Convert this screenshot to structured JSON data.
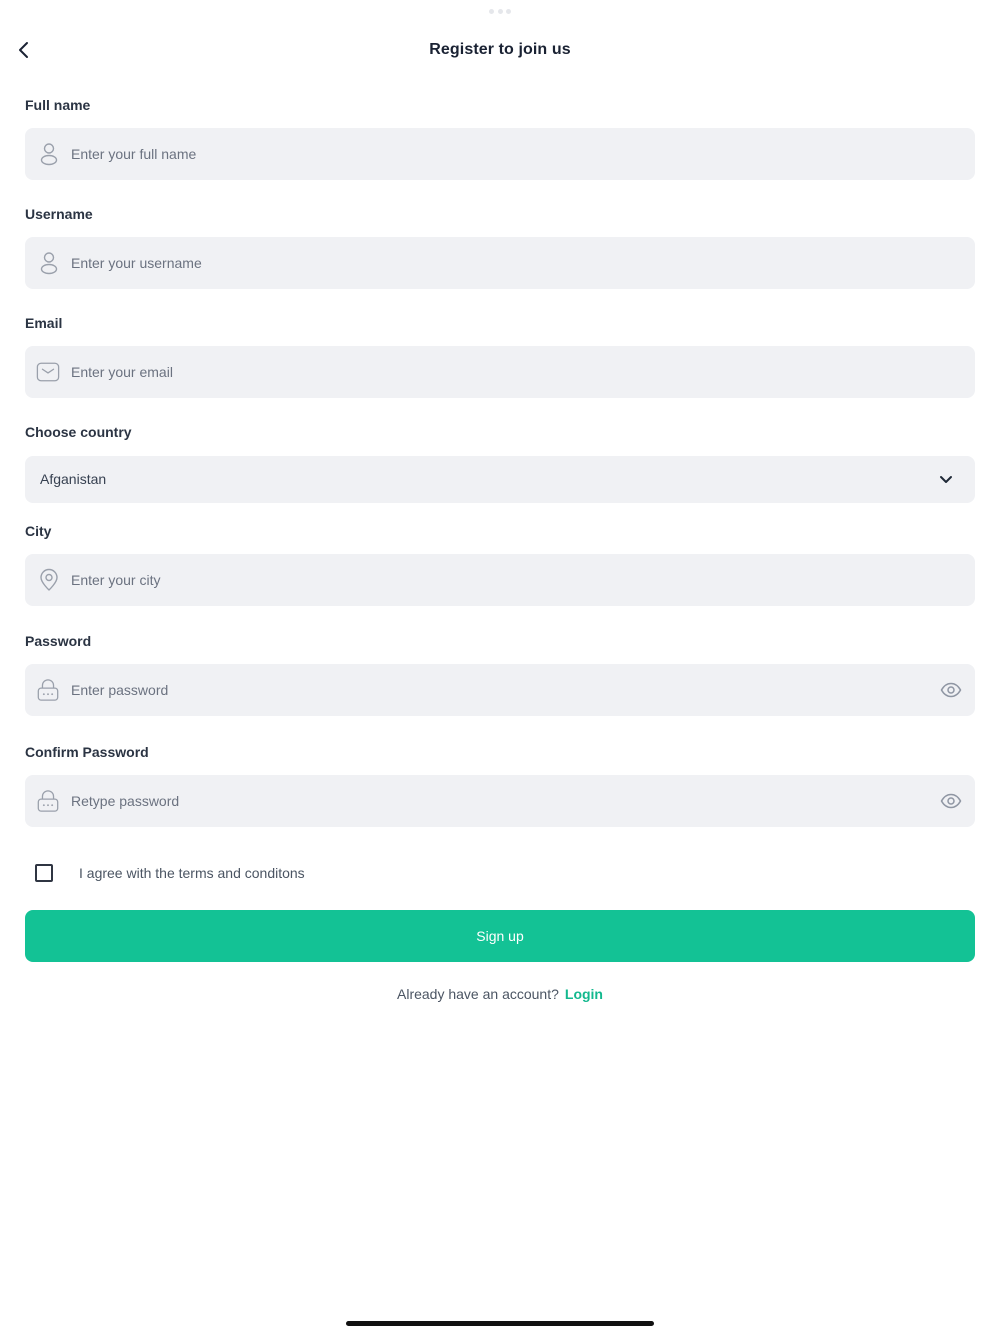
{
  "header": {
    "title": "Register to join us",
    "back_icon": "chevron-left-icon"
  },
  "form": {
    "full_name": {
      "label": "Full name",
      "placeholder": "Enter your full name",
      "value": "",
      "icon": "user-icon"
    },
    "username": {
      "label": "Username",
      "placeholder": "Enter your username",
      "value": "",
      "icon": "user-icon"
    },
    "email": {
      "label": "Email",
      "placeholder": "Enter your email",
      "value": "",
      "icon": "mail-icon"
    },
    "country": {
      "label": "Choose country",
      "selected": "Afganistan",
      "icon": "chevron-down-icon"
    },
    "city": {
      "label": "City",
      "placeholder": "Enter your city",
      "value": "",
      "icon": "location-pin-icon"
    },
    "password": {
      "label": "Password",
      "placeholder": "Enter password",
      "value": "",
      "icon": "lock-icon",
      "toggle_icon": "eye-icon"
    },
    "confirm_password": {
      "label": "Confirm Password",
      "placeholder": "Retype password",
      "value": "",
      "icon": "lock-icon",
      "toggle_icon": "eye-icon"
    },
    "terms": {
      "label": "I agree with the terms and conditons",
      "checked": false
    },
    "submit_label": "Sign up"
  },
  "footer": {
    "prompt": "Already have an account?",
    "login_label": "Login"
  },
  "colors": {
    "accent": "#13c295",
    "field_bg": "#f0f1f4",
    "text_dark": "#1a2233",
    "placeholder": "#6b7280"
  }
}
